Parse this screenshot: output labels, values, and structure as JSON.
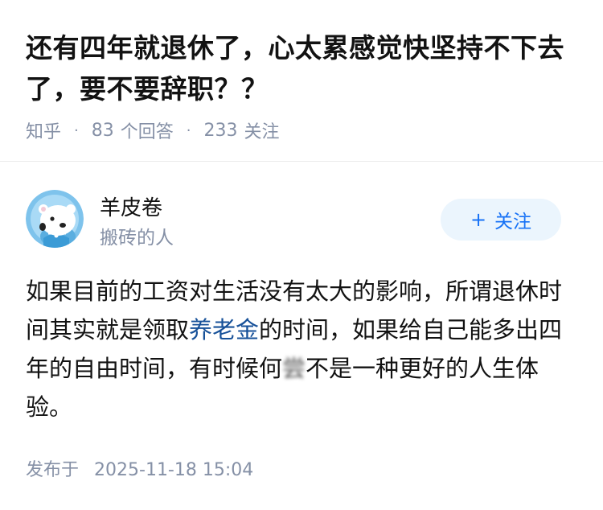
{
  "question": {
    "title": "还有四年就退休了，心太累感觉快坚持不下去了，要不要辞职？？",
    "source": "知乎",
    "answer_count": "83",
    "answer_label": "个回答",
    "follower_count": "233",
    "follower_label": "关注"
  },
  "author": {
    "name": "羊皮卷",
    "bio": "搬砖的人",
    "follow_plus": "+",
    "follow_label": "关注",
    "avatar_icon": "polar-bear-avatar-icon"
  },
  "answer": {
    "part1": "如果目前的工资对生活没有太大的影响，所谓退休时间其实就是领取",
    "link": "养老金",
    "part2": "的时间，如果给自己能多出四年的自由时间，有时候何",
    "blurred": "尝",
    "part3": "不是一种更好的人生体验。"
  },
  "footer": {
    "publish_label": "发布于",
    "publish_time": "2025-11-18 15:04"
  },
  "colors": {
    "meta_gray": "#8590a6",
    "brand_blue": "#1772f6",
    "follow_bg": "#ebf5fd",
    "link_blue": "#175199"
  }
}
